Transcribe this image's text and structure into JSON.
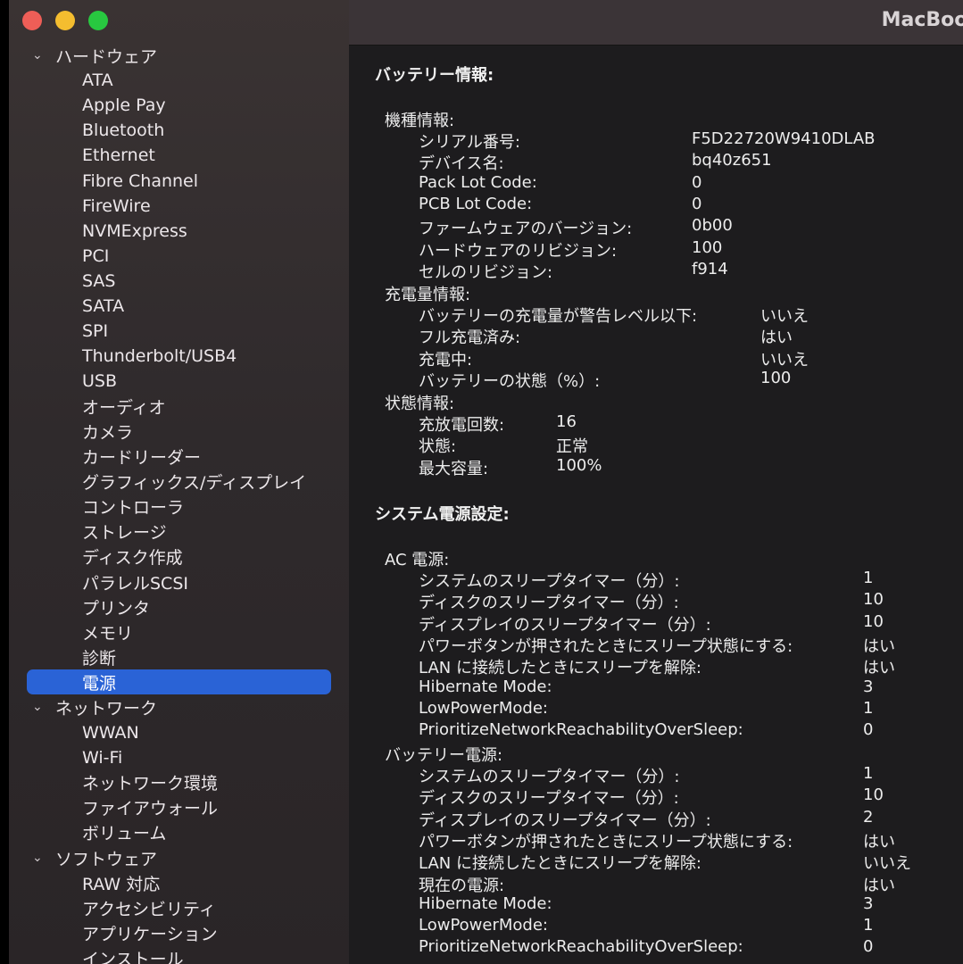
{
  "window": {
    "title": "MacBook"
  },
  "sidebar": {
    "groups": [
      {
        "label": "ハードウェア",
        "items": [
          "ATA",
          "Apple Pay",
          "Bluetooth",
          "Ethernet",
          "Fibre Channel",
          "FireWire",
          "NVMExpress",
          "PCI",
          "SAS",
          "SATA",
          "SPI",
          "Thunderbolt/USB4",
          "USB",
          "オーディオ",
          "カメラ",
          "カードリーダー",
          "グラフィックス/ディスプレイ",
          "コントローラ",
          "ストレージ",
          "ディスク作成",
          "パラレルSCSI",
          "プリンタ",
          "メモリ",
          "診断",
          "電源"
        ]
      },
      {
        "label": "ネットワーク",
        "items": [
          "WWAN",
          "Wi-Fi",
          "ネットワーク環境",
          "ファイアウォール",
          "ボリューム"
        ]
      },
      {
        "label": "ソフトウェア",
        "items": [
          "RAW 対応",
          "アクセシビリティ",
          "アプリケーション",
          "インストール"
        ]
      }
    ],
    "selected": "電源"
  },
  "content": {
    "battery_header": "バッテリー情報:",
    "model_header": "機種情報:",
    "model": [
      {
        "label": "シリアル番号:",
        "value": "F5D22720W9410DLAB"
      },
      {
        "label": "デバイス名:",
        "value": "bq40z651"
      },
      {
        "label": "Pack Lot Code:",
        "value": "0"
      },
      {
        "label": "PCB Lot Code:",
        "value": "0"
      },
      {
        "label": "ファームウェアのバージョン:",
        "value": "0b00"
      },
      {
        "label": "ハードウェアのリビジョン:",
        "value": "100"
      },
      {
        "label": "セルのリビジョン:",
        "value": "f914"
      }
    ],
    "charge_header": "充電量情報:",
    "charge": [
      {
        "label": "バッテリーの充電量が警告レベル以下:",
        "value": "いいえ"
      },
      {
        "label": "フル充電済み:",
        "value": "はい"
      },
      {
        "label": "充電中:",
        "value": "いいえ"
      },
      {
        "label": "バッテリーの状態（%）:",
        "value": "100"
      }
    ],
    "health_header": "状態情報:",
    "health": [
      {
        "label": "充放電回数:",
        "value": "16"
      },
      {
        "label": "状態:",
        "value": "正常"
      },
      {
        "label": "最大容量:",
        "value": "100%"
      }
    ],
    "power_header": "システム電源設定:",
    "ac_header": "AC 電源:",
    "ac": [
      {
        "label": "システムのスリープタイマー（分）:",
        "value": "1"
      },
      {
        "label": "ディスクのスリープタイマー（分）:",
        "value": "10"
      },
      {
        "label": "ディスプレイのスリープタイマー（分）:",
        "value": "10"
      },
      {
        "label": "パワーボタンが押されたときにスリープ状態にする:",
        "value": "はい"
      },
      {
        "label": "LAN に接続したときにスリープを解除:",
        "value": "はい"
      },
      {
        "label": "Hibernate Mode:",
        "value": "3"
      },
      {
        "label": "LowPowerMode:",
        "value": "1"
      },
      {
        "label": "PrioritizeNetworkReachabilityOverSleep:",
        "value": "0"
      }
    ],
    "bat_header": "バッテリー電源:",
    "bat": [
      {
        "label": "システムのスリープタイマー（分）:",
        "value": "1"
      },
      {
        "label": "ディスクのスリープタイマー（分）:",
        "value": "10"
      },
      {
        "label": "ディスプレイのスリープタイマー（分）:",
        "value": "2"
      },
      {
        "label": "パワーボタンが押されたときにスリープ状態にする:",
        "value": "はい"
      },
      {
        "label": "LAN に接続したときにスリープを解除:",
        "value": "いいえ"
      },
      {
        "label": "現在の電源:",
        "value": "はい"
      },
      {
        "label": "Hibernate Mode:",
        "value": "3"
      },
      {
        "label": "LowPowerMode:",
        "value": "1"
      },
      {
        "label": "PrioritizeNetworkReachabilityOverSleep:",
        "value": "0"
      }
    ]
  }
}
